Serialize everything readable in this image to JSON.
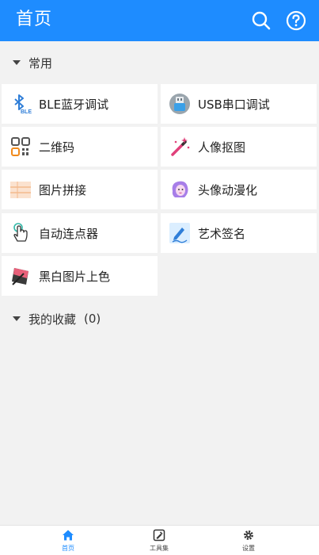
{
  "header": {
    "title": "首页",
    "search_icon": "search-icon",
    "help_icon": "help-circle-icon"
  },
  "common": {
    "title": "常用",
    "tools": [
      {
        "label": "BLE蓝牙调试",
        "icon": "bluetooth-icon"
      },
      {
        "label": "USB串口调试",
        "icon": "usb-icon"
      },
      {
        "label": "二维码",
        "icon": "qrcode-icon"
      },
      {
        "label": "人像抠图",
        "icon": "magic-wand-icon"
      },
      {
        "label": "图片拼接",
        "icon": "image-stitch-icon"
      },
      {
        "label": "头像动漫化",
        "icon": "anime-avatar-icon"
      },
      {
        "label": "自动连点器",
        "icon": "tap-hand-icon"
      },
      {
        "label": "艺术签名",
        "icon": "signature-pen-icon"
      },
      {
        "label": "黑白图片上色",
        "icon": "colorize-icon"
      }
    ]
  },
  "favorites": {
    "title": "我的收藏",
    "count": "(0)"
  },
  "bottom_nav": [
    {
      "label": "首页",
      "icon": "home-icon",
      "active": true
    },
    {
      "label": "工具集",
      "icon": "toolbox-icon",
      "active": false
    },
    {
      "label": "设置",
      "icon": "gear-icon",
      "active": false
    }
  ],
  "colors": {
    "primary": "#1e8cff",
    "background": "#f2f2f2",
    "tile": "#ffffff"
  }
}
